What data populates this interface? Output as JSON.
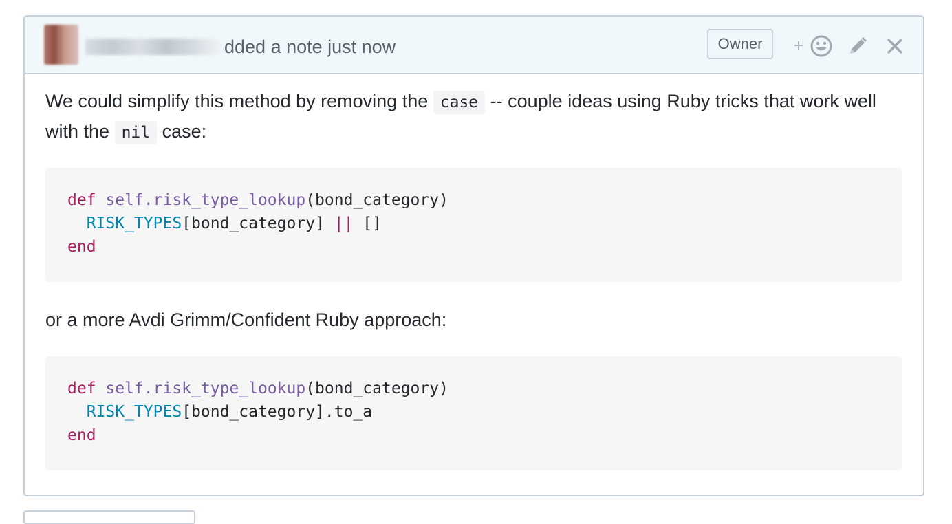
{
  "header": {
    "action_text": "dded a note just now",
    "badge": "Owner",
    "reaction_plus": "+"
  },
  "body": {
    "para1": {
      "t1": "We could simplify this method by removing the ",
      "code1": "case",
      "t2": " -- couple ideas using Ruby tricks that work well with the ",
      "code2": "nil",
      "t3": " case:"
    },
    "block1": {
      "kw_def": "def",
      "sig": "self.risk_type_lookup",
      "args": "(bond_category)",
      "const": "RISK_TYPES",
      "index": "[bond_category] ",
      "op": "||",
      "rest": " []",
      "kw_end": "end"
    },
    "para2": "or a more Avdi Grimm/Confident Ruby approach:",
    "block2": {
      "kw_def": "def",
      "sig": "self.risk_type_lookup",
      "args": "(bond_category)",
      "const": "RISK_TYPES",
      "rest": "[bond_category].to_a",
      "kw_end": "end"
    }
  },
  "icons": {
    "reaction": "smiley-icon",
    "edit": "pencil-icon",
    "close": "close-icon"
  },
  "colors": {
    "keyword": "#a71d5d",
    "method": "#795da3",
    "constant": "#0086b3",
    "header_bg": "#f1f8fb",
    "border": "#c8d1d9"
  }
}
